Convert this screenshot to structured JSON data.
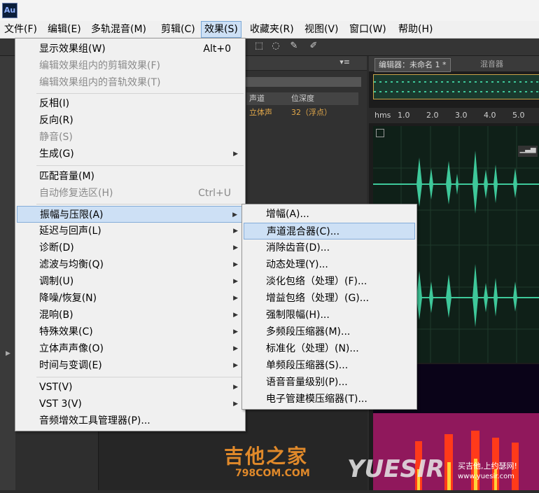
{
  "app": {
    "logo_text": "Au"
  },
  "menubar": [
    {
      "label": "文件(F)"
    },
    {
      "label": "编辑(E)"
    },
    {
      "label": "多轨混音(M)"
    },
    {
      "label": "剪辑(C)"
    },
    {
      "label": "效果(S)"
    },
    {
      "label": "收藏夹(R)"
    },
    {
      "label": "视图(V)"
    },
    {
      "label": "窗口(W)"
    },
    {
      "label": "帮助(H)"
    }
  ],
  "effects_menu": {
    "items": [
      {
        "label": "显示效果组(W)",
        "shortcut": "Alt+0",
        "enabled": true,
        "submenu": false
      },
      {
        "label": "编辑效果组内的剪辑效果(F)",
        "enabled": false,
        "submenu": false
      },
      {
        "label": "编辑效果组内的音轨效果(T)",
        "enabled": false,
        "submenu": false
      },
      {
        "label": "反相(I)",
        "enabled": true,
        "submenu": false
      },
      {
        "label": "反向(R)",
        "enabled": true,
        "submenu": false
      },
      {
        "label": "静音(S)",
        "enabled": false,
        "submenu": false
      },
      {
        "label": "生成(G)",
        "enabled": true,
        "submenu": true
      },
      {
        "label": "匹配音量(M)",
        "enabled": true,
        "submenu": false
      },
      {
        "label": "自动修复选区(H)",
        "shortcut": "Ctrl+U",
        "enabled": false,
        "submenu": false
      },
      {
        "label": "振幅与压限(A)",
        "enabled": true,
        "submenu": true,
        "highlighted": true
      },
      {
        "label": "延迟与回声(L)",
        "enabled": true,
        "submenu": true
      },
      {
        "label": "诊断(D)",
        "enabled": true,
        "submenu": true
      },
      {
        "label": "滤波与均衡(Q)",
        "enabled": true,
        "submenu": true
      },
      {
        "label": "调制(U)",
        "enabled": true,
        "submenu": true
      },
      {
        "label": "降噪/恢复(N)",
        "enabled": true,
        "submenu": true
      },
      {
        "label": "混响(B)",
        "enabled": true,
        "submenu": true
      },
      {
        "label": "特殊效果(C)",
        "enabled": true,
        "submenu": true
      },
      {
        "label": "立体声声像(O)",
        "enabled": true,
        "submenu": true
      },
      {
        "label": "时间与变调(E)",
        "enabled": true,
        "submenu": true
      },
      {
        "label": "VST(V)",
        "enabled": true,
        "submenu": true
      },
      {
        "label": "VST 3(V)",
        "enabled": true,
        "submenu": true
      },
      {
        "label": "音频增效工具管理器(P)...",
        "enabled": true,
        "submenu": false
      }
    ]
  },
  "amplitude_submenu": {
    "items": [
      {
        "label": "增幅(A)..."
      },
      {
        "label": "声道混合器(C)...",
        "highlighted": true
      },
      {
        "label": "消除齿音(D)..."
      },
      {
        "label": "动态处理(Y)..."
      },
      {
        "label": "淡化包络（处理）(F)..."
      },
      {
        "label": "增益包络（处理）(G)..."
      },
      {
        "label": "强制限幅(H)..."
      },
      {
        "label": "多频段压缩器(M)..."
      },
      {
        "label": "标准化（处理）(N)..."
      },
      {
        "label": "单频段压缩器(S)..."
      },
      {
        "label": "语音音量级别(P)..."
      },
      {
        "label": "电子管建模压缩器(T)..."
      }
    ]
  },
  "files_panel": {
    "col_channel": "声道",
    "col_bitdepth": "位深度",
    "row_channel": "立体声",
    "row_bitdepth": "32（浮点）"
  },
  "editor": {
    "tab_editor": "编辑器：未命名 1 *",
    "tab_mixer": "混音器",
    "ruler_unit": "hms",
    "ruler_ticks": [
      "1.0",
      "2.0",
      "3.0",
      "4.0",
      "5.0"
    ]
  },
  "watermark": {
    "site_cn": "吉他之家",
    "site_url": "798COM.COM",
    "brand": "YUESIR",
    "slogan": "买吉他,上约瑟网!",
    "url": "www.yuesir.com"
  },
  "colors": {
    "menu_highlight": "#cde0f5",
    "waveform": "#3ec89a",
    "watermark_orange": "#e0892a"
  }
}
